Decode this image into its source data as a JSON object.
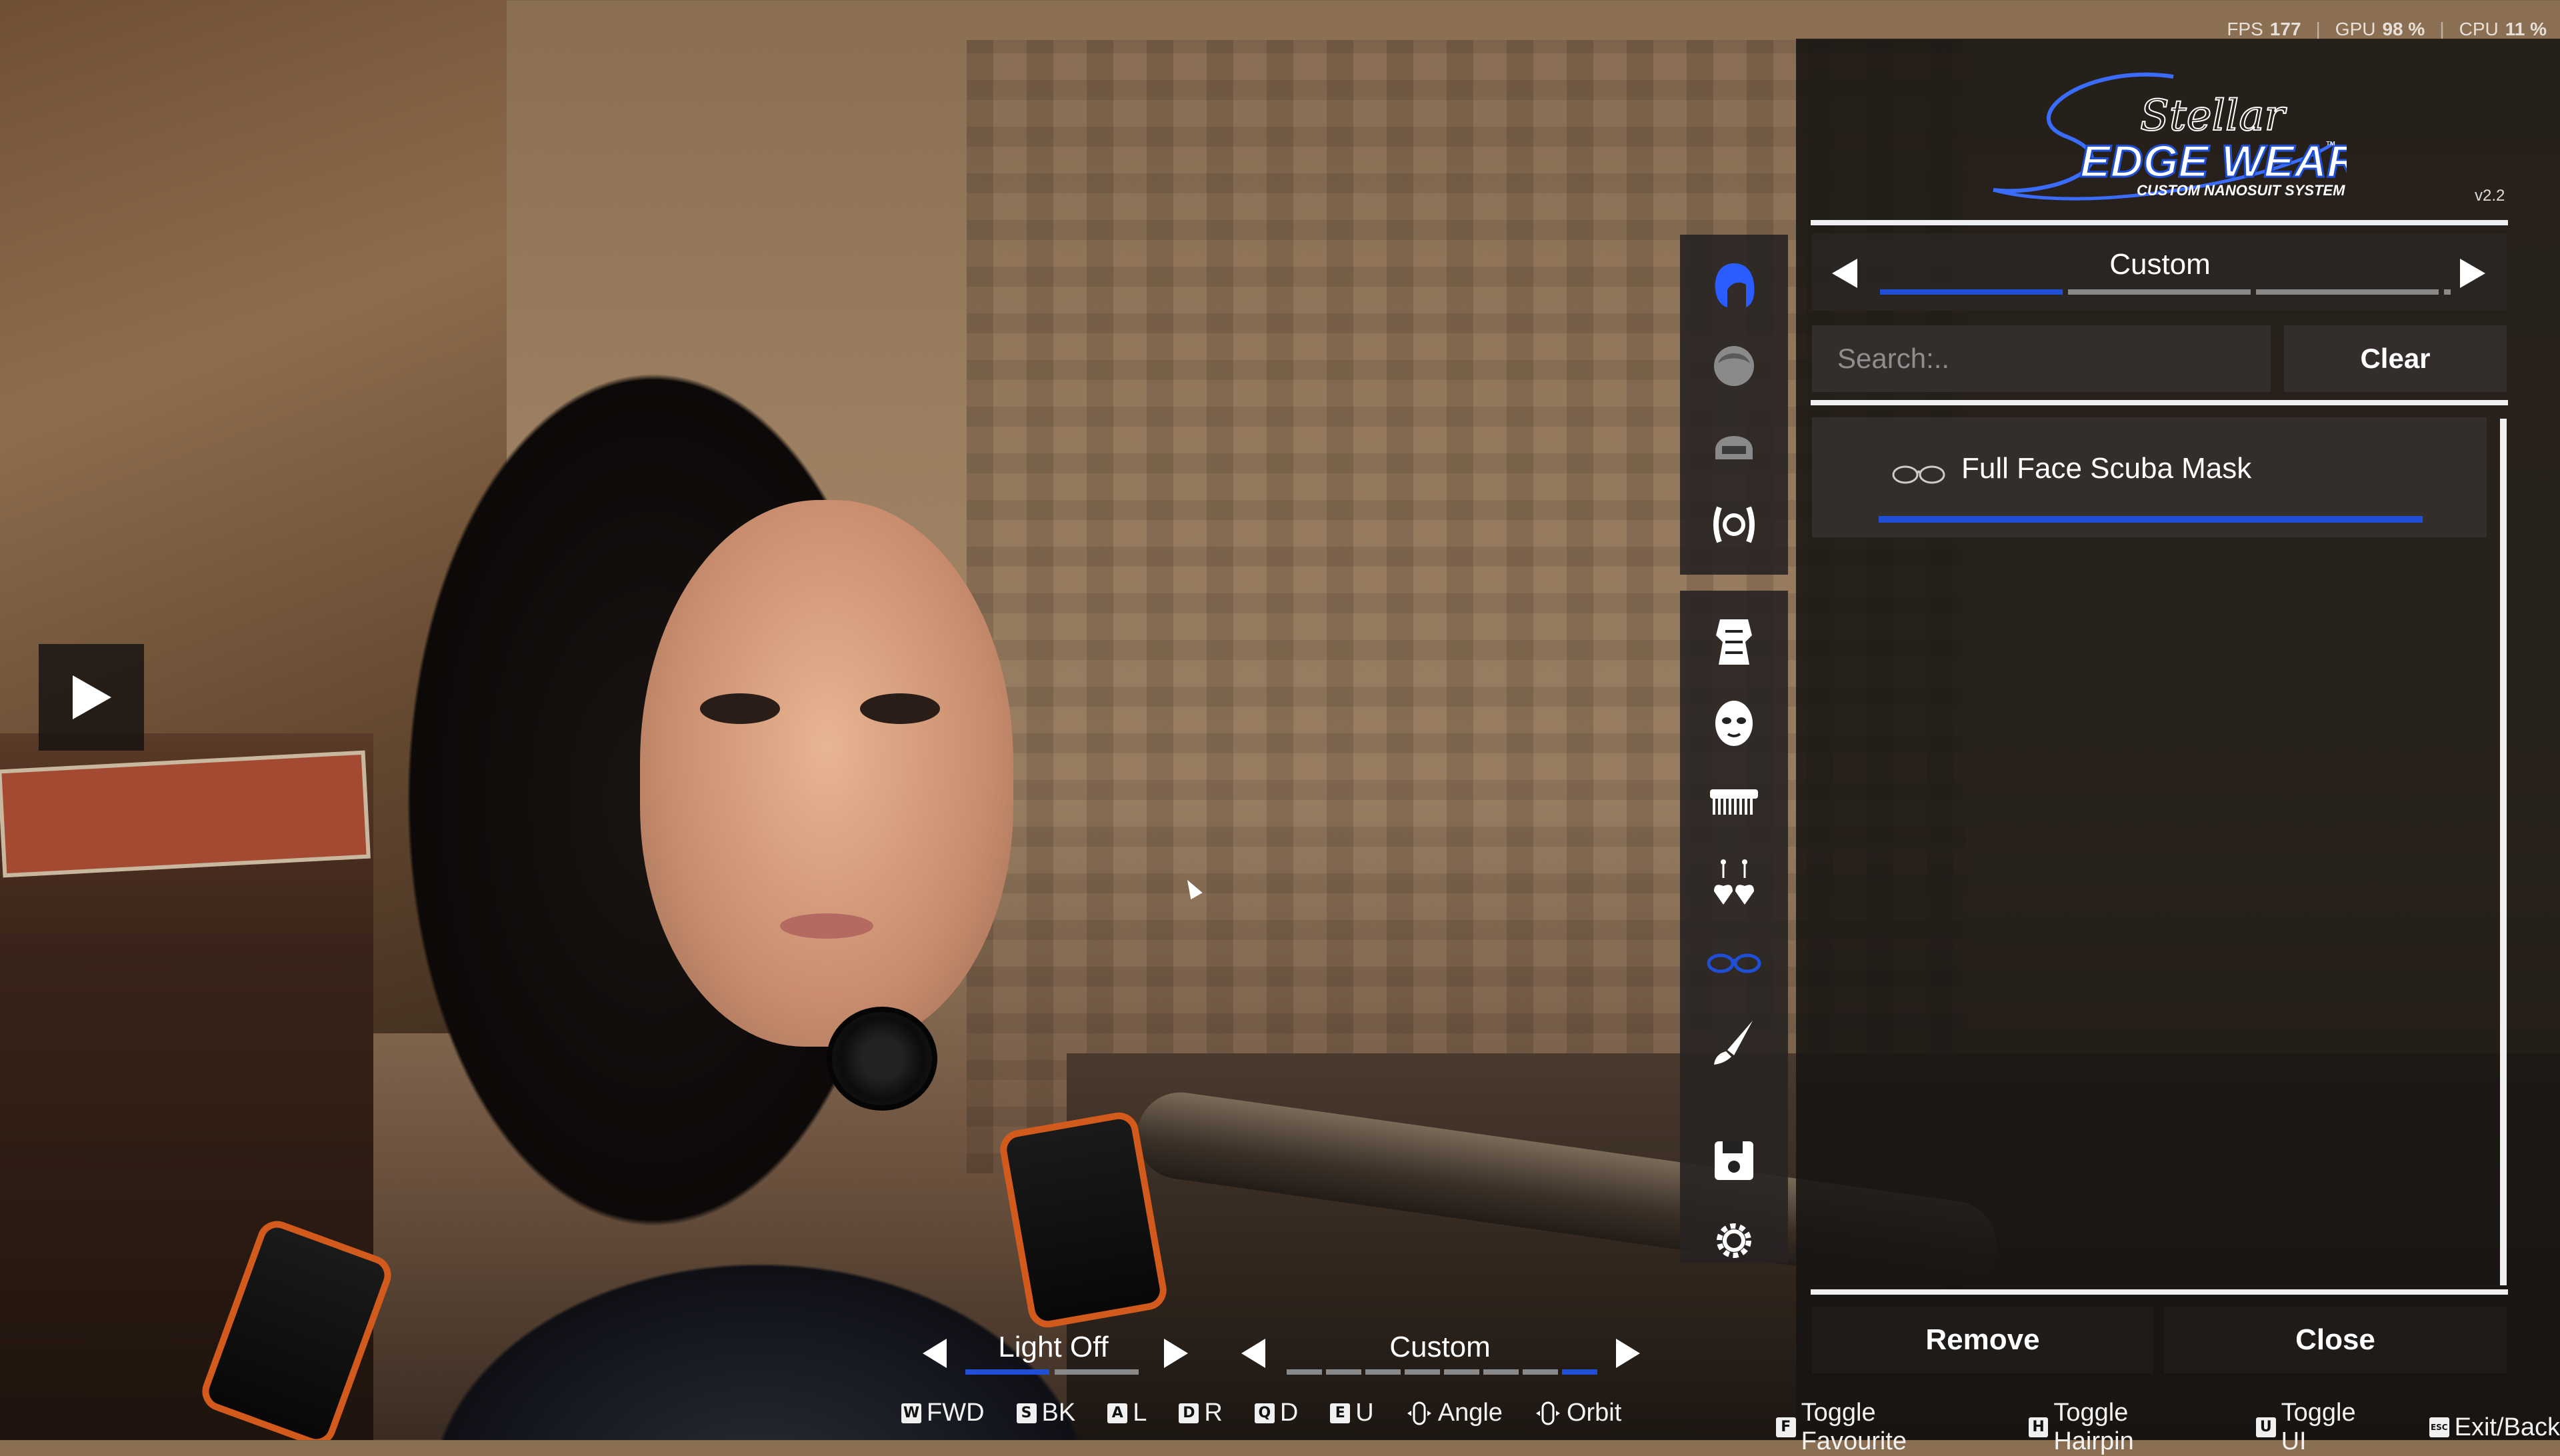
{
  "perf": {
    "fps_label": "FPS",
    "fps": "177",
    "gpu_label": "GPU",
    "gpu": "98 %",
    "cpu_label": "CPU",
    "cpu": "11 %"
  },
  "logo": {
    "script": "Stellar",
    "title": "EDGE WEAR",
    "tm": "™",
    "subtitle": "CUSTOM NANOSUIT SYSTEM",
    "version": "v2.2"
  },
  "selector": {
    "label": "Custom",
    "segments": 4,
    "active_segment": 1
  },
  "search": {
    "placeholder": "Search:..",
    "clear": "Clear"
  },
  "items": [
    {
      "label": "Full Face Scuba Mask",
      "icon": "mask-icon",
      "progress": 1.0
    }
  ],
  "category_icons_top": [
    "hair-icon",
    "hair-alt-icon",
    "helmet-icon",
    "ears-icon"
  ],
  "category_icons_bottom": [
    "bodysuit-icon",
    "face-icon",
    "comb-icon",
    "earrings-icon",
    "glasses-icon",
    "brush-icon",
    "save-icon",
    "settings-icon"
  ],
  "actions": {
    "remove": "Remove",
    "close": "Close"
  },
  "light_pager": {
    "label": "Light Off",
    "segments": 2,
    "active_segment": 1
  },
  "preset_pager": {
    "label": "Custom",
    "segments": 8,
    "active_segment": 8
  },
  "hints_left": [
    {
      "key": "W",
      "label": "FWD"
    },
    {
      "key": "S",
      "label": "BK"
    },
    {
      "key": "A",
      "label": "L"
    },
    {
      "key": "D",
      "label": "R"
    },
    {
      "key": "Q",
      "label": "D"
    },
    {
      "key": "E",
      "label": "U"
    },
    {
      "key": "mouse-icon",
      "label": "Angle"
    },
    {
      "key": "mouse-icon",
      "label": "Orbit"
    }
  ],
  "hints_right": [
    {
      "key": "F",
      "label": "Toggle Favourite"
    },
    {
      "key": "H",
      "label": "Toggle Hairpin"
    },
    {
      "key": "U",
      "label": "Toggle UI"
    },
    {
      "key": "ESC",
      "label": "Exit/Back"
    }
  ],
  "colors": {
    "accent": "#1e4fd6",
    "inactive_segment": "#8a8a8a",
    "panel": "#181412"
  }
}
